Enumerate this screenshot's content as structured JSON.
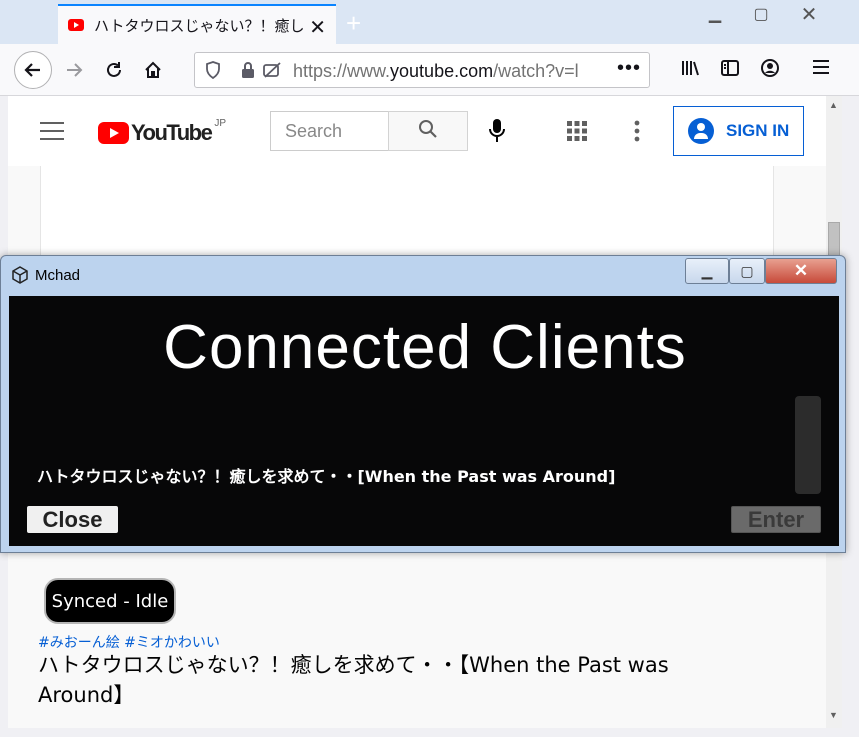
{
  "browser": {
    "tab_title": "ハトタウロスじゃない？！癒し",
    "url_prefix": "https://www.",
    "url_host": "youtube.com",
    "url_path": "/watch?v=l",
    "icons": [
      "back-icon",
      "forward-icon",
      "reload-icon",
      "home-icon",
      "shield-icon",
      "lock-icon",
      "tracking-icon",
      "library-icon",
      "sidebar-icon",
      "account-icon",
      "menu-icon"
    ]
  },
  "youtube": {
    "region": "JP",
    "logo_text": "YouTube",
    "search_placeholder": "Search",
    "signin_label": "SIGN IN",
    "status_badge": "Synced - Idle",
    "hashtags": "#みおーん絵 #ミオかわいい",
    "video_title": "ハトタウロスじゃない？！癒しを求めて・・【When the Past was Around】"
  },
  "mchad": {
    "window_title": "Mchad",
    "heading": "Connected Clients",
    "track_text": "ハトタウロスじゃない？！癒しを求めて・・[When the Past was Around]",
    "close_label": "Close",
    "enter_label": "Enter"
  },
  "colors": {
    "youtube_red": "#ff0000",
    "signin_blue": "#065fd4",
    "overlay_bg": "#070708",
    "tab_accent": "#0a84ff"
  }
}
